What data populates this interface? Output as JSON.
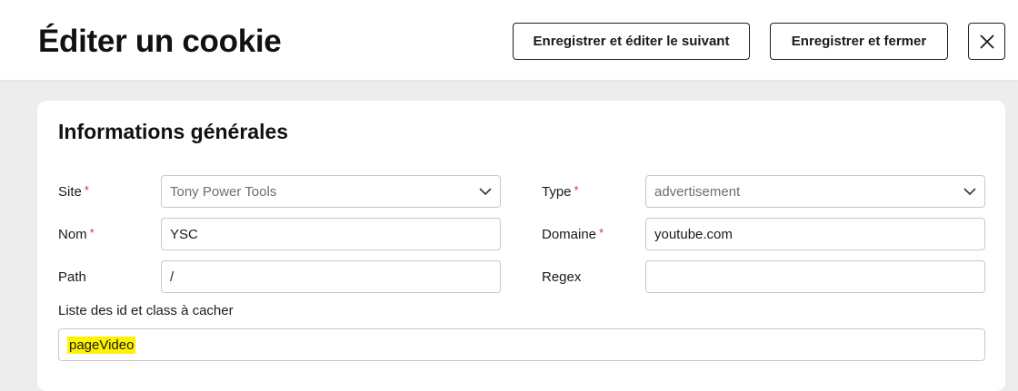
{
  "header": {
    "title": "Éditer un cookie",
    "save_next_label": "Enregistrer et éditer le suivant",
    "save_close_label": "Enregistrer et fermer"
  },
  "section": {
    "title": "Informations générales"
  },
  "form": {
    "site": {
      "label": "Site",
      "required": "*",
      "value": "Tony Power Tools"
    },
    "type": {
      "label": "Type",
      "required": "*",
      "value": "advertisement"
    },
    "nom": {
      "label": "Nom",
      "required": "*",
      "value": "YSC"
    },
    "domaine": {
      "label": "Domaine",
      "required": "*",
      "value": "youtube.com"
    },
    "path": {
      "label": "Path",
      "value": "/"
    },
    "regex": {
      "label": "Regex",
      "value": ""
    },
    "hide_list": {
      "label": "Liste des id et class à cacher",
      "value": "pageVideo"
    }
  },
  "colors": {
    "required": "#d9342b",
    "highlight": "#fff200",
    "background": "#ededed"
  }
}
